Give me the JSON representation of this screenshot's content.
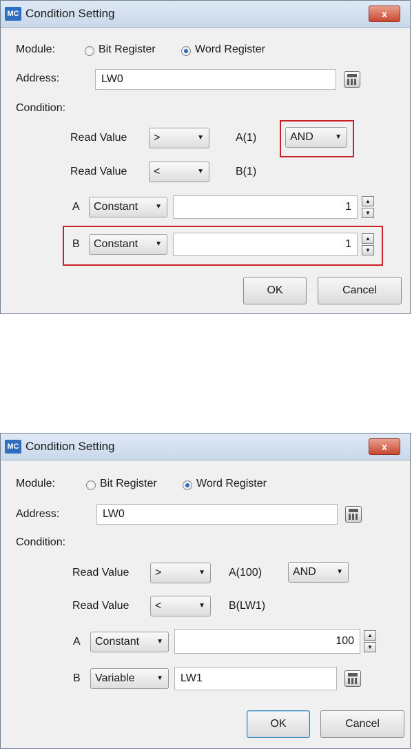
{
  "dialogs": [
    {
      "app_icon": "MC",
      "title": "Condition Setting",
      "close_label": "x",
      "module_label": "Module:",
      "bit_register": "Bit Register",
      "word_register": "Word Register",
      "selected_module": "Word Register",
      "address_label": "Address:",
      "address_value": "LW0",
      "condition_label": "Condition:",
      "read_value_1": "Read Value",
      "op1": ">",
      "operand_a": "A(1)",
      "logic": "AND",
      "read_value_2": "Read Value",
      "op2": "<",
      "operand_b": "B(1)",
      "a_label": "A",
      "a_type": "Constant",
      "a_value": "1",
      "b_label": "B",
      "b_type": "Constant",
      "b_value": "1",
      "ok": "OK",
      "cancel": "Cancel",
      "highlight_color": "#c8202a"
    },
    {
      "app_icon": "MC",
      "title": "Condition Setting",
      "close_label": "x",
      "module_label": "Module:",
      "bit_register": "Bit Register",
      "word_register": "Word Register",
      "selected_module": "Word Register",
      "address_label": "Address:",
      "address_value": "LW0",
      "condition_label": "Condition:",
      "read_value_1": "Read Value",
      "op1": ">",
      "operand_a": "A(100)",
      "logic": "AND",
      "read_value_2": "Read Value",
      "op2": "<",
      "operand_b": "B(LW1)",
      "a_label": "A",
      "a_type": "Constant",
      "a_value": "100",
      "b_label": "B",
      "b_type": "Variable",
      "b_value": "LW1",
      "ok": "OK",
      "cancel": "Cancel"
    }
  ]
}
